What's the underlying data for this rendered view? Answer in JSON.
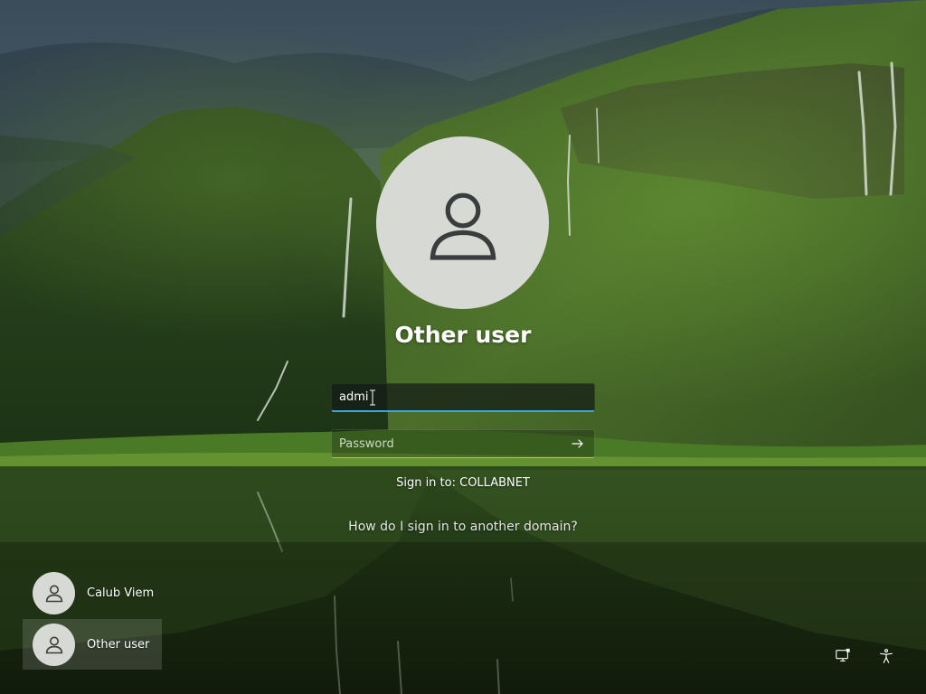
{
  "login": {
    "title": "Other user",
    "username_value": "admi",
    "password_placeholder": "Password",
    "sign_in_to": "Sign in to: COLLABNET",
    "domain_help_link": "How do I sign in to another domain?"
  },
  "user_list": [
    {
      "name": "Calub Viem",
      "selected": false
    },
    {
      "name": "Other user",
      "selected": true
    }
  ],
  "icons": {
    "avatar": "person-icon",
    "submit": "arrow-right-icon",
    "network": "network-icon",
    "accessibility": "accessibility-icon"
  },
  "colors": {
    "focus_accent": "#3ba7e0",
    "avatar_bg": "#d7d9d4",
    "avatar_glyph": "#3a3d3e"
  }
}
